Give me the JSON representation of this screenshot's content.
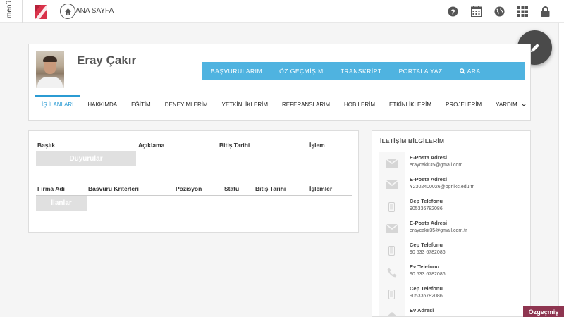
{
  "topbar": {
    "menu_label": "menü",
    "home_label": "ANA SAYFA",
    "icons": [
      "help-icon",
      "calendar-icon",
      "globe-icon",
      "apps-grid-icon",
      "lock-icon"
    ]
  },
  "profile": {
    "name": "Eray Çakır",
    "action_links": [
      "BAŞVURULARIM",
      "ÖZ GEÇMİŞİM",
      "TRANSKRİPT",
      "PORTALA YAZ",
      "ARA"
    ],
    "tabs": [
      "İŞ İLANLARI",
      "HAKKIMDA",
      "EĞİTİM",
      "DENEYİMLERİM",
      "YETKİNLİKLERİM",
      "REFERANSLARIM",
      "HOBİLERİM",
      "ETKİNLİKLERİM",
      "PROJELERİM",
      "YARDIM"
    ],
    "active_tab": "İŞ İLANLARI"
  },
  "announcements": {
    "headers": [
      "Başlık",
      "Açıklama",
      "Bitiş Tarihi",
      "İşlem"
    ],
    "button": "Duyurular"
  },
  "jobs": {
    "headers": [
      "Firma Adı",
      "Basvuru Kriterleri",
      "Pozisyon",
      "Statü",
      "Bitiş Tarihi",
      "İşlemler"
    ],
    "button": "İlanlar"
  },
  "contact": {
    "title": "İLETİŞİM BİLGİLERİM",
    "items": [
      {
        "icon": "mail-icon",
        "label": "E-Posta Adresi",
        "value": "eraycakir35@gmail.com"
      },
      {
        "icon": "mail-icon",
        "label": "E-Posta Adresi",
        "value": "Y2302400026@ogr.ikc.edu.tr"
      },
      {
        "icon": "mobile-phone-icon",
        "label": "Cep Telefonu",
        "value": "905336782086"
      },
      {
        "icon": "mail-icon",
        "label": "E-Posta Adresi",
        "value": "eraycakir35@gmail.com.tr"
      },
      {
        "icon": "mobile-phone-icon",
        "label": "Cep Telefonu",
        "value": "90 533 6782086"
      },
      {
        "icon": "phone-icon",
        "label": "Ev Telefonu",
        "value": "90 533 6782086"
      },
      {
        "icon": "mobile-phone-icon",
        "label": "Cep Telefonu",
        "value": "905336782086"
      },
      {
        "icon": "home-address-icon",
        "label": "Ev Adresi",
        "value": ""
      }
    ]
  },
  "footer_badge": "Özgeçmiş",
  "colors": {
    "accent_blue": "#4fb3e0",
    "active_tab": "#2b9bd3",
    "logo_red": "#d9324a",
    "badge": "#8e3550"
  }
}
